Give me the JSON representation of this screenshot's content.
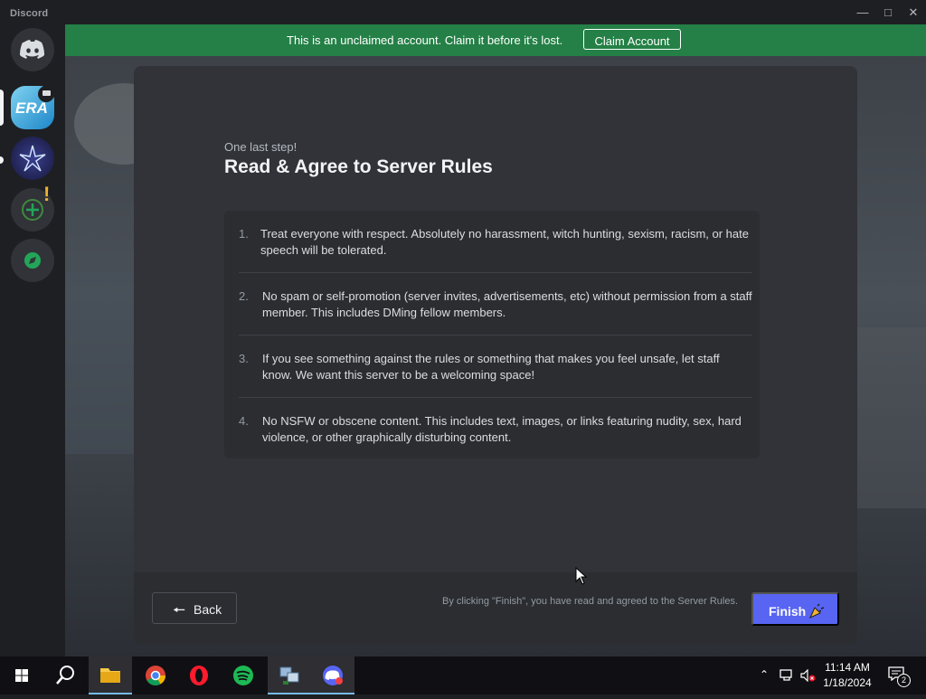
{
  "window": {
    "app_name": "Discord",
    "minimize_icon": "minimize-icon",
    "maximize_icon": "maximize-icon",
    "close_icon": "close-icon"
  },
  "banner": {
    "message": "This is an unclaimed account. Claim it before it's lost.",
    "claim_label": "Claim Account",
    "color": "#248046"
  },
  "servers": [
    {
      "name": "discord-home",
      "icon": "discord-logo-icon"
    },
    {
      "name": "era-server",
      "label": "ERA",
      "badge_icon": "voice-chat-icon"
    },
    {
      "name": "crystal-server",
      "icon": "crystal-star-icon"
    },
    {
      "name": "add-server",
      "icon": "plus-icon",
      "alert": "!"
    },
    {
      "name": "explore-servers",
      "icon": "compass-icon"
    }
  ],
  "onboarding": {
    "eyebrow": "One last step!",
    "title": "Read & Agree to Server Rules",
    "rules": [
      {
        "num": "1.",
        "text": "Treat everyone with respect. Absolutely no harassment, witch hunting, sexism, racism, or hate speech will be tolerated."
      },
      {
        "num": "2.",
        "text": "No spam or self-promotion (server invites, advertisements, etc) without permission from a staff member. This includes DMing fellow members."
      },
      {
        "num": "3.",
        "text": "If you see something against the rules or something that makes you feel unsafe, let staff know. We want this server to be a welcoming space!"
      },
      {
        "num": "4.",
        "text": "No NSFW or obscene content. This includes text, images, or links featuring nudity, sex, hard violence, or other graphically disturbing content."
      }
    ],
    "back_label": "Back",
    "consent_text": "By clicking \"Finish\", you have read and agreed to the Server Rules.",
    "finish_label": "Finish",
    "accent": "#5865f2"
  },
  "taskbar": {
    "apps": [
      "start-icon",
      "search-icon",
      "file-explorer-icon",
      "chrome-icon",
      "opera-icon",
      "spotify-icon",
      "network-tool-icon",
      "discord-icon"
    ],
    "time": "11:14 AM",
    "date": "1/18/2024",
    "notification_count": "2"
  }
}
